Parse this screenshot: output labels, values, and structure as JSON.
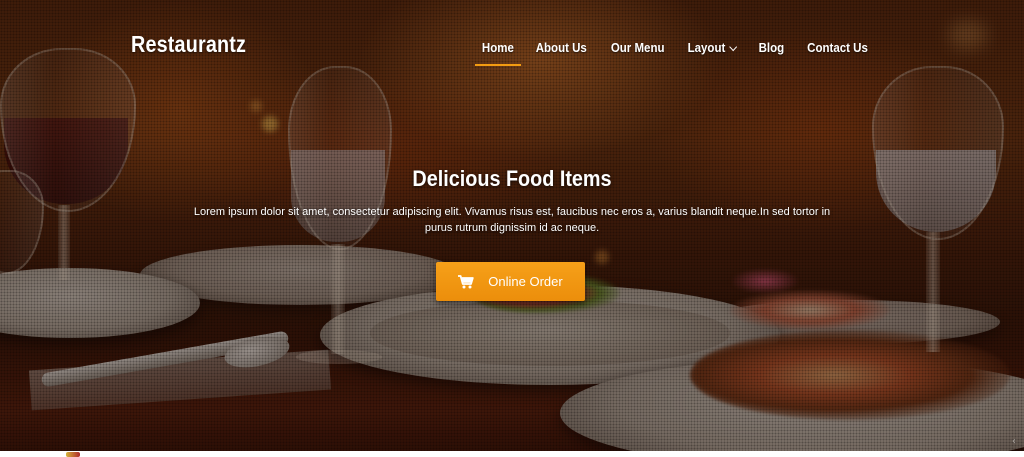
{
  "brand": {
    "name": "Restaurantz"
  },
  "nav": {
    "items": [
      {
        "label": "Home",
        "active": true
      },
      {
        "label": "About Us",
        "active": false
      },
      {
        "label": "Our Menu",
        "active": false
      },
      {
        "label": "Layout",
        "active": false,
        "dropdown": true
      },
      {
        "label": "Blog",
        "active": false
      },
      {
        "label": "Contact Us",
        "active": false
      }
    ]
  },
  "hero": {
    "title": "Delicious Food Items",
    "text": "Lorem ipsum dolor sit amet, consectetur adipiscing elit. Vivamus risus est, faucibus nec eros a, varius blandit neque.In sed tortor in purus rutrum dignissim id ac neque.",
    "button_label": "Online Order",
    "button_icon": "shopping-cart-icon"
  },
  "colors": {
    "accent": "#f39c12",
    "button": "#ef950f",
    "text": "#ffffff"
  }
}
